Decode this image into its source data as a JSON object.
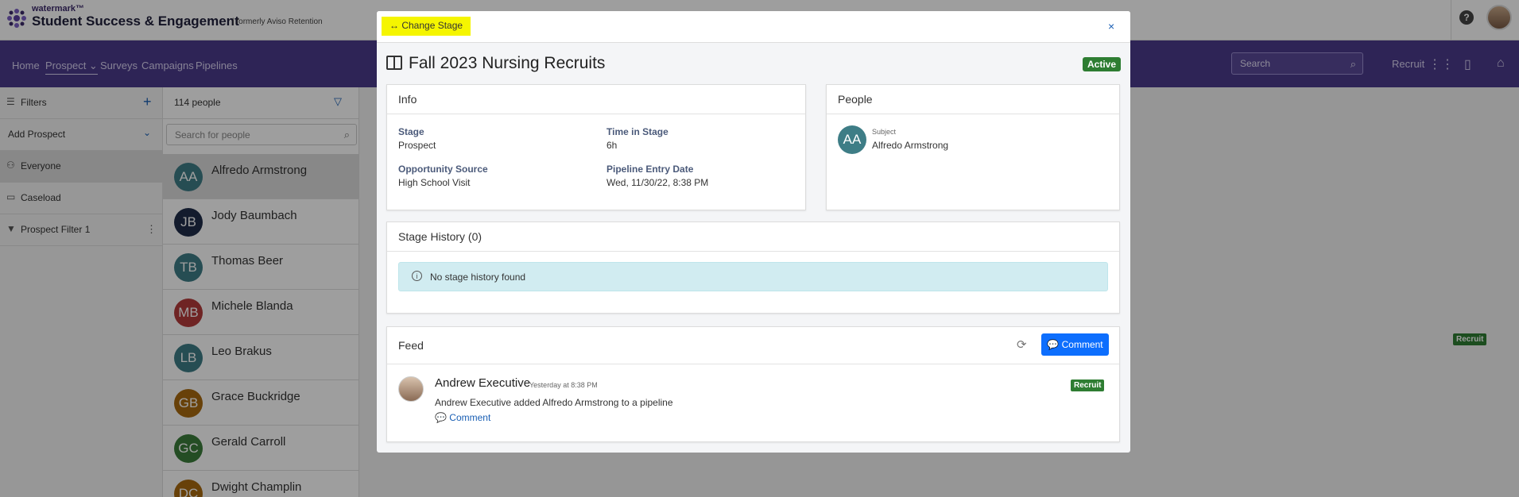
{
  "app": {
    "brand_small": "watermark™",
    "brand_title": "Student Success & Engagement",
    "brand_formerly": "| formerly Aviso Retention"
  },
  "nav": {
    "items": [
      "Home",
      "Prospect ⌄",
      "Surveys",
      "Campaigns",
      "Pipelines"
    ],
    "search_placeholder": "Search",
    "recruit_label": "Recruit"
  },
  "sidebar": {
    "filters_label": "Filters",
    "add_prospect_label": "Add Prospect",
    "items": [
      "Everyone",
      "Caseload",
      "Prospect Filter 1"
    ]
  },
  "people": {
    "count_label": "114 people",
    "search_placeholder": "Search for people",
    "list": [
      {
        "initials": "AA",
        "name": "Alfredo Armstrong",
        "color": "#3e7d86"
      },
      {
        "initials": "JB",
        "name": "Jody Baumbach",
        "color": "#1f2d4a"
      },
      {
        "initials": "TB",
        "name": "Thomas Beer",
        "color": "#3e7d86"
      },
      {
        "initials": "MB",
        "name": "Michele Blanda",
        "color": "#b33b3b"
      },
      {
        "initials": "LB",
        "name": "Leo Brakus",
        "color": "#3e7d86"
      },
      {
        "initials": "GB",
        "name": "Grace Buckridge",
        "color": "#a86a10"
      },
      {
        "initials": "GC",
        "name": "Gerald Carroll",
        "color": "#3a7d3a"
      },
      {
        "initials": "DC",
        "name": "Dwight Champlin",
        "color": "#a86a10"
      }
    ]
  },
  "modal": {
    "change_stage": "↔ Change Stage",
    "close": "×",
    "title": "Fall 2023 Nursing Recruits",
    "status": "Active",
    "info": {
      "title": "Info",
      "stage_label": "Stage",
      "stage_value": "Prospect",
      "time_label": "Time in Stage",
      "time_value": "6h",
      "source_label": "Opportunity Source",
      "source_value": "High School Visit",
      "entry_label": "Pipeline Entry Date",
      "entry_value": "Wed, 11/30/22, 8:38 PM"
    },
    "people": {
      "title": "People",
      "subject_initials": "AA",
      "subject_label": "Subject",
      "subject_name": "Alfredo Armstrong"
    },
    "stage_history": {
      "title": "Stage History (0)",
      "empty_text": "No stage history found"
    },
    "feed": {
      "title": "Feed",
      "comment_button": "💬 Comment",
      "entry": {
        "author": "Andrew Executive",
        "time": "Yesterday at 8:38 PM",
        "text": "Andrew Executive added Alfredo Armstrong to a pipeline",
        "comment_link": "💬 Comment",
        "badge": "Recruit"
      }
    }
  },
  "background": {
    "recruit_badge": "Recruit"
  },
  "colors": {
    "nav_bg": "#4b3a8c",
    "highlight": "#f5f500",
    "primary": "#0d6efd",
    "success": "#2e7d32"
  }
}
